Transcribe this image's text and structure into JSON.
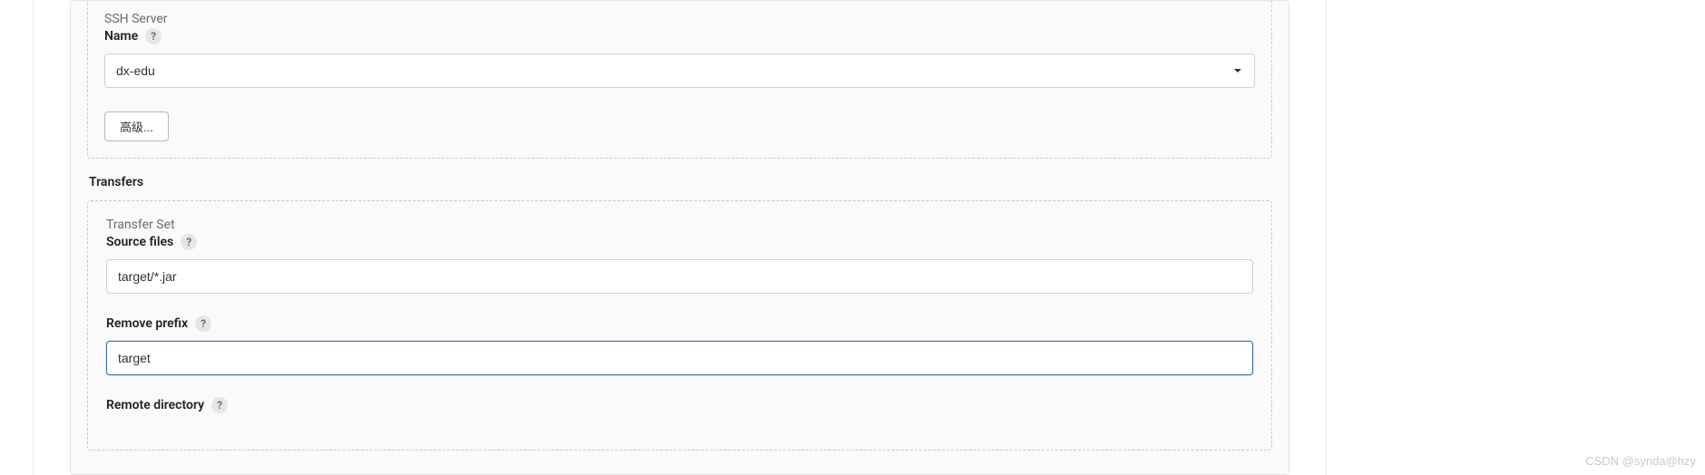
{
  "ssh_server": {
    "section_title": "SSH Server",
    "name_label": "Name",
    "name_value": "dx-edu",
    "advanced_label": "高级..."
  },
  "transfers": {
    "heading": "Transfers",
    "transfer_set_title": "Transfer Set",
    "source_files": {
      "label": "Source files",
      "value": "target/*.jar"
    },
    "remove_prefix": {
      "label": "Remove prefix",
      "value": "target"
    },
    "remote_directory": {
      "label": "Remote directory"
    }
  },
  "help_glyph": "?",
  "watermark": "CSDN @synda@hzy"
}
